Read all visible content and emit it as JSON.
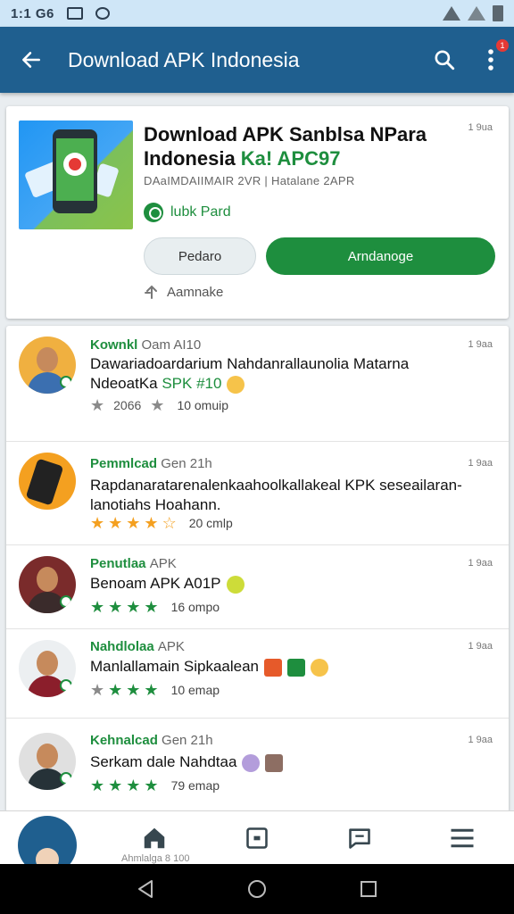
{
  "status_bar": {
    "time": "1:1 G6"
  },
  "app_bar": {
    "title": "Download APK Indonesia",
    "notification_count": "1"
  },
  "app_card": {
    "title_line1": "Download APK Sanblsa NPara",
    "title_line2_prefix": "Indonesia ",
    "title_line2_highlight": "Ka! APC97",
    "subtitle": "DAaIMDAIIMAIR 2VR | Hatalane 2APR",
    "meta": "1 9ua",
    "developer": "lubk Pard",
    "secondary_button": "Pedaro",
    "primary_button": "Arndanoge",
    "share_label": "Aamnake"
  },
  "reviews": [
    {
      "name": "Kownkl",
      "name_suffix": "Oam AI10",
      "time": "1 9aa",
      "text_main": "Dawariadoardarium Nahdanrallaunolia Matarna ",
      "text_line2_prefix": "NdeoatKa ",
      "text_highlight": "SPK #10",
      "rating_value": "2066",
      "rating_count": "10 omuip",
      "stars": [
        "gray",
        "gray"
      ]
    },
    {
      "name": "Pemmlcad",
      "name_suffix": "Gen 21h",
      "time": "1 9aa",
      "text_main": "Rapdanaratarenalenkaahoolkallakeal KPK seseailaran-lanotiahs Hoahann.",
      "text_line2_prefix": "",
      "text_highlight": "",
      "rating_value": "",
      "rating_count": "20 cmlp",
      "stars": [
        "gold",
        "gold",
        "gold",
        "gold",
        "gold"
      ]
    },
    {
      "name": "Penutlaa",
      "name_suffix": "APK",
      "time": "1 9aa",
      "text_main": "Benoam APK A01P",
      "text_line2_prefix": "",
      "text_highlight": "",
      "rating_value": "",
      "rating_count": "16 ompo",
      "stars": [
        "green",
        "green",
        "green",
        "green",
        "green"
      ]
    },
    {
      "name": "Nahdlolaa",
      "name_suffix": "APK",
      "time": "1 9aa",
      "text_main": "Manlallamain Sipkaalean",
      "text_line2_prefix": "",
      "text_highlight": "",
      "rating_value": "",
      "rating_count": "10 emap",
      "stars": [
        "gray",
        "green",
        "green",
        "green"
      ]
    },
    {
      "name": "Kehnalcad",
      "name_suffix": "Gen 21h",
      "time": "1 9aa",
      "text_main": "Serkam dale Nahdtaa",
      "text_line2_prefix": "",
      "text_highlight": "",
      "rating_value": "",
      "rating_count": "79 emap",
      "stars": [
        "green",
        "green",
        "green",
        "green"
      ]
    }
  ],
  "bottom_nav": {
    "caption": "Ahmlalga 8 100"
  },
  "colors": {
    "primary": "#1f5f8f",
    "accent_green": "#1e8e3e",
    "status_bar": "#cfe6f7"
  }
}
